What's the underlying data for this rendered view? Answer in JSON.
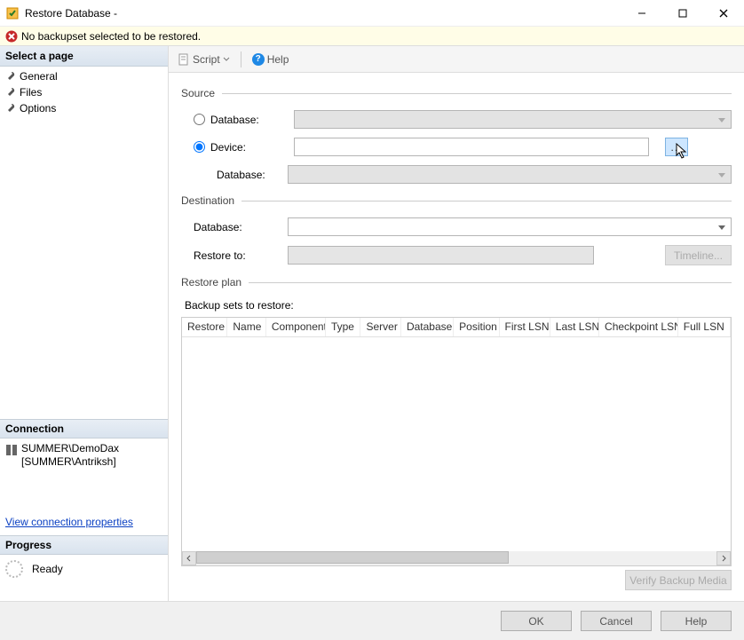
{
  "title": "Restore Database -",
  "notice": "No backupset selected to be restored.",
  "sidebar": {
    "select_page": "Select a page",
    "items": [
      "General",
      "Files",
      "Options"
    ],
    "connection_header": "Connection",
    "connection_server": "SUMMER\\DemoDax",
    "connection_user": "[SUMMER\\Antriksh]",
    "view_conn_props": "View connection properties",
    "progress_header": "Progress",
    "progress_status": "Ready"
  },
  "toolbar": {
    "script": "Script",
    "help": "Help"
  },
  "source": {
    "label": "Source",
    "database_radio": "Database:",
    "device_radio": "Device:",
    "database_sub": "Database:",
    "source_selected": "device"
  },
  "destination": {
    "label": "Destination",
    "database": "Database:",
    "restore_to": "Restore to:",
    "timeline_btn": "Timeline..."
  },
  "restore_plan": {
    "label": "Restore plan",
    "backup_sets": "Backup sets to restore:",
    "columns": [
      "Restore",
      "Name",
      "Component",
      "Type",
      "Server",
      "Database",
      "Position",
      "First LSN",
      "Last LSN",
      "Checkpoint LSN",
      "Full LSN"
    ]
  },
  "verify_btn": "Verify Backup Media",
  "footer": {
    "ok": "OK",
    "cancel": "Cancel",
    "help": "Help"
  }
}
